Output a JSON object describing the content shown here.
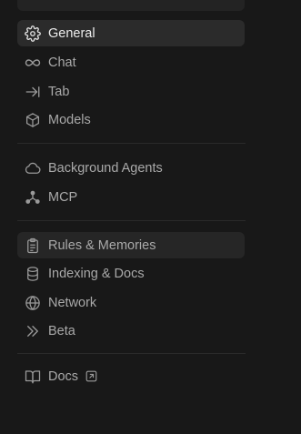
{
  "sidebar": {
    "items": [
      {
        "label": "General",
        "icon": "gear-icon"
      },
      {
        "label": "Chat",
        "icon": "infinity-icon"
      },
      {
        "label": "Tab",
        "icon": "arrow-right-bar-icon"
      },
      {
        "label": "Models",
        "icon": "cube-icon"
      },
      {
        "label": "Background Agents",
        "icon": "cloud-icon"
      },
      {
        "label": "MCP",
        "icon": "nodes-icon"
      },
      {
        "label": "Rules & Memories",
        "icon": "clipboard-icon"
      },
      {
        "label": "Indexing & Docs",
        "icon": "database-icon"
      },
      {
        "label": "Network",
        "icon": "globe-icon"
      },
      {
        "label": "Beta",
        "icon": "double-chevron-right-icon"
      },
      {
        "label": "Docs",
        "icon": "book-icon",
        "external_icon": "external-link-icon"
      }
    ],
    "active_item": "General",
    "highlighted_item": "Rules & Memories"
  },
  "colors": {
    "background": "#181818",
    "active_bg": "#2b2b2b",
    "hover_bg": "#262626",
    "text": "#a9a9a9",
    "active_text": "#ececec",
    "divider": "#2a2a2a"
  }
}
